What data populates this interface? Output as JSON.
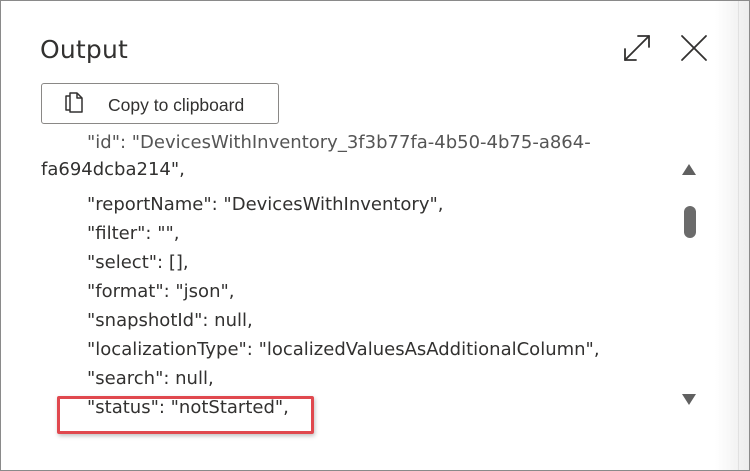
{
  "dialog": {
    "title": "Output",
    "icons": {
      "expand": "expand-icon",
      "close": "close-icon",
      "copy": "copy-icon"
    }
  },
  "toolbar": {
    "copy_label": "Copy to clipboard"
  },
  "output": {
    "lines": [
      "\"id\": \"DevicesWithInventory_3f3b77fa-4b50-4b75-a864-",
      "fa694dcba214\",",
      "\"reportName\": \"DevicesWithInventory\",",
      "\"filter\": \"\",",
      "\"select\": [],",
      "\"format\": \"json\",",
      "\"snapshotId\": null,",
      "\"localizationType\": \"localizedValuesAsAdditionalColumn\",",
      "\"search\": null,",
      "\"status\": \"notStarted\","
    ]
  },
  "colors": {
    "highlight": "#e0484e",
    "text": "#323130"
  }
}
